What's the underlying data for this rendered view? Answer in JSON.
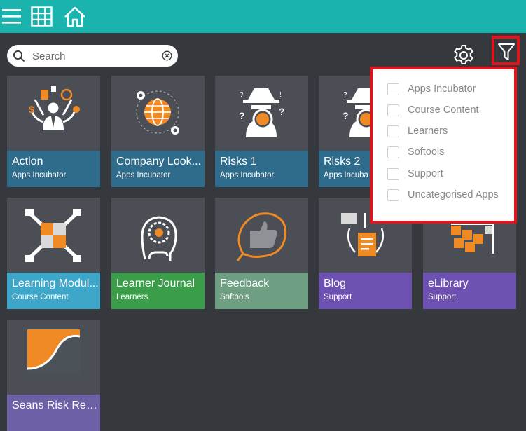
{
  "search": {
    "placeholder": "Search"
  },
  "tiles": [
    {
      "title": "Action",
      "category": "Apps Incubator",
      "band_color": "#2f6b8a"
    },
    {
      "title": "Company Look...",
      "category": "Apps Incubator",
      "band_color": "#2f6b8a"
    },
    {
      "title": "Risks 1",
      "category": "Apps Incubator",
      "band_color": "#2f6b8a"
    },
    {
      "title": "Risks 2",
      "category": "Apps Incuba",
      "band_color": "#2f6b8a"
    },
    {
      "title": "Learning Modul...",
      "category": "Course Content",
      "band_color": "#3ea7c9"
    },
    {
      "title": "Learner Journal",
      "category": "Learners",
      "band_color": "#3b9d4a"
    },
    {
      "title": "Feedback",
      "category": "Softools",
      "band_color": "#6e9f82"
    },
    {
      "title": "Blog",
      "category": "Support",
      "band_color": "#6d51b0"
    },
    {
      "title": "eLibrary",
      "category": "Support",
      "band_color": "#6d51b0"
    },
    {
      "title": "Seans Risk Regi...",
      "category": "",
      "band_color": "#6d60a6"
    }
  ],
  "filter": {
    "options": [
      {
        "label": "Apps Incubator",
        "checked": false
      },
      {
        "label": "Course Content",
        "checked": false
      },
      {
        "label": "Learners",
        "checked": false
      },
      {
        "label": "Softools",
        "checked": false
      },
      {
        "label": "Support",
        "checked": false
      },
      {
        "label": "Uncategorised Apps",
        "checked": false
      }
    ]
  },
  "colors": {
    "topbar": "#1bb3ae",
    "highlight": "#e0141b",
    "accent_orange": "#f08a24"
  }
}
